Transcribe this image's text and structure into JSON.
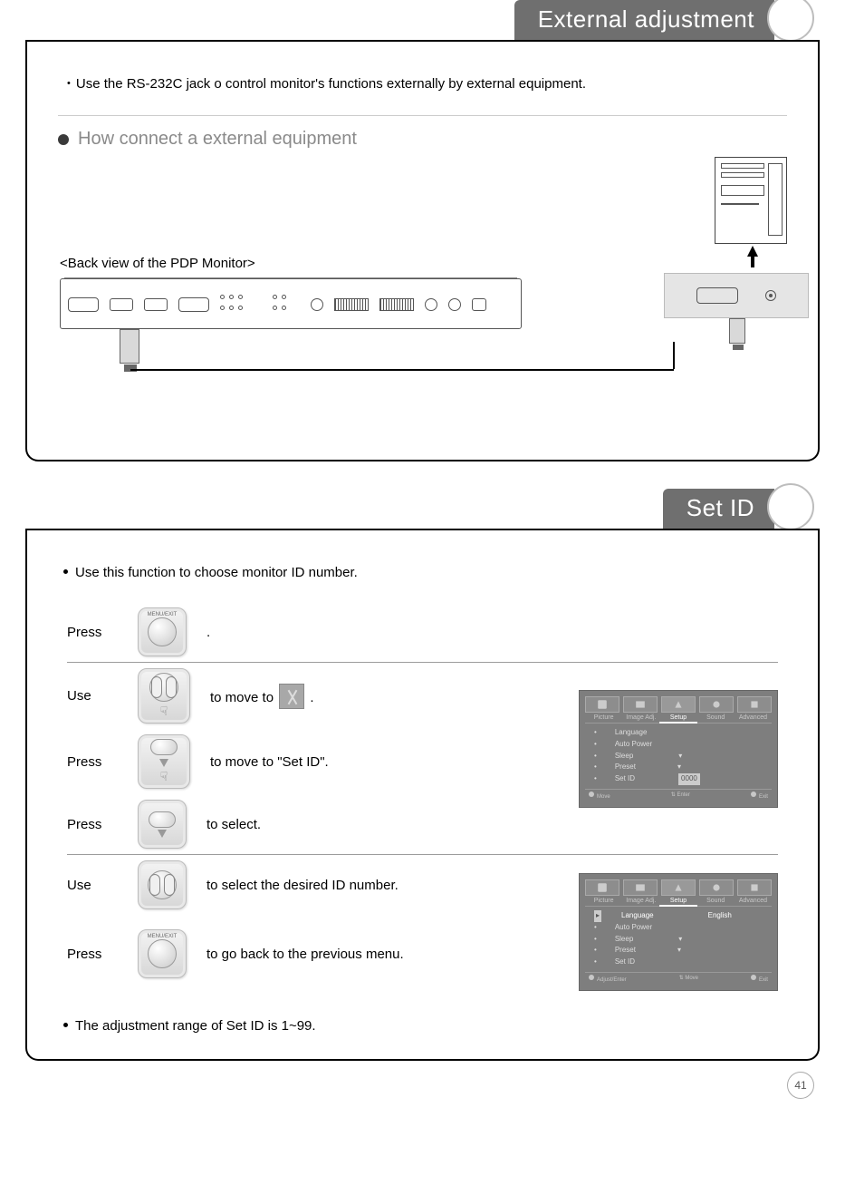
{
  "section1": {
    "title": "External adjustment",
    "intro": "Use the RS-232C jack o control monitor's functions externally by external equipment.",
    "subheading": "How connect a external equipment",
    "back_view_label": "<Back view of the PDP Monitor>"
  },
  "section2": {
    "title": "Set ID",
    "intro": "Use this function to choose monitor ID number.",
    "steps": {
      "s1_action": "Press",
      "s1_text": ".",
      "s1_btn_label": "MENU/EXIT",
      "s2_action": "Use",
      "s2_text_a": "to move to ",
      "s2_text_b": ".",
      "s3_action": "Press",
      "s3_text": "to move to \"Set ID\".",
      "s4_action": "Press",
      "s4_text": "to select.",
      "s5_action": "Use",
      "s5_text": "to select the desired ID number.",
      "s6_action": "Press",
      "s6_text": "to go back to the previous menu.",
      "s6_btn_label": "MENU/EXIT"
    },
    "footer_note": "The adjustment range of Set ID is 1~99.",
    "osd1": {
      "tabs": [
        "Picture",
        "Image Adj.",
        "Setup",
        "Sound",
        "Advanced"
      ],
      "active_tab": "Setup",
      "items": [
        "Language",
        "Auto Power",
        "Sleep",
        "Preset",
        "Set ID"
      ],
      "values": [
        "",
        "",
        "",
        "",
        "0000"
      ],
      "status": [
        "Move",
        "Enter",
        "Exit"
      ]
    },
    "osd2": {
      "tabs": [
        "Picture",
        "Image Adj.",
        "Setup",
        "Sound",
        "Advanced"
      ],
      "active_tab": "Setup",
      "items": [
        "Language",
        "Auto Power",
        "Sleep",
        "Preset",
        "Set ID"
      ],
      "item_active": "Language",
      "value_active": "English",
      "status": [
        "Adjust/Enter",
        "Move",
        "Exit"
      ]
    }
  },
  "page_number": "41"
}
